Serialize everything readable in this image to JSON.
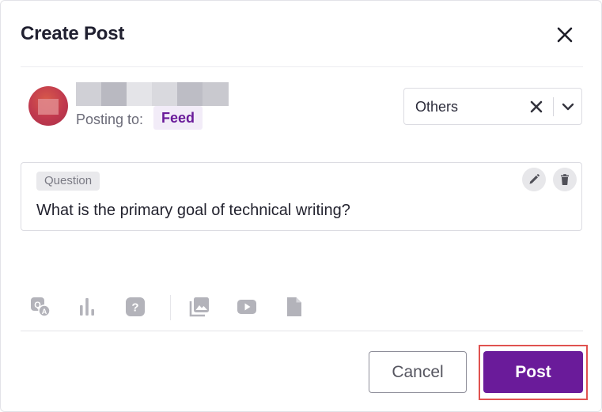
{
  "dialog": {
    "title": "Create Post",
    "close_icon": "close-icon"
  },
  "author": {
    "posting_to_label": "Posting to:",
    "destination": "Feed"
  },
  "category": {
    "selected": "Others",
    "clear_icon": "close-icon",
    "dropdown_icon": "chevron-down-icon"
  },
  "question": {
    "tag": "Question",
    "text": "What is the primary goal of technical writing?",
    "edit_icon": "pencil-icon",
    "delete_icon": "trash-icon"
  },
  "toolbar": {
    "items": [
      {
        "icon": "qa-icon"
      },
      {
        "icon": "poll-icon"
      },
      {
        "icon": "question-icon"
      },
      {
        "icon": "image-gallery-icon"
      },
      {
        "icon": "video-icon"
      },
      {
        "icon": "document-icon"
      }
    ]
  },
  "footer": {
    "cancel_label": "Cancel",
    "post_label": "Post"
  },
  "colors": {
    "brand": "#6a1b9a",
    "highlight": "#e0524f"
  }
}
